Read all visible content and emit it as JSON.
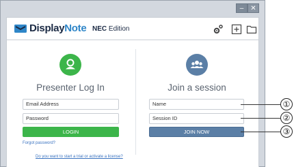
{
  "window": {
    "minimize_glyph": "–",
    "close_glyph": "✕"
  },
  "toolbar": {
    "brand_part1": "Display",
    "brand_part2": "Note",
    "edition_bold": "NEC",
    "edition_text": "Edition"
  },
  "presenter": {
    "heading": "Presenter Log In",
    "email_placeholder": "Email Address",
    "password_placeholder": "Password",
    "login_label": "LOGIN",
    "forgot_label": "Forgot password?",
    "trial_label": "Do you want to start a trial or activate a license?"
  },
  "join": {
    "heading": "Join a session",
    "name_placeholder": "Name",
    "session_placeholder": "Session ID",
    "join_label": "JOIN NOW"
  },
  "callouts": [
    "①",
    "②",
    "③"
  ],
  "colors": {
    "green": "#3cb54a",
    "blue": "#5b7fa6",
    "brand_dark": "#1b2a44",
    "brand_blue": "#2f86c8"
  }
}
